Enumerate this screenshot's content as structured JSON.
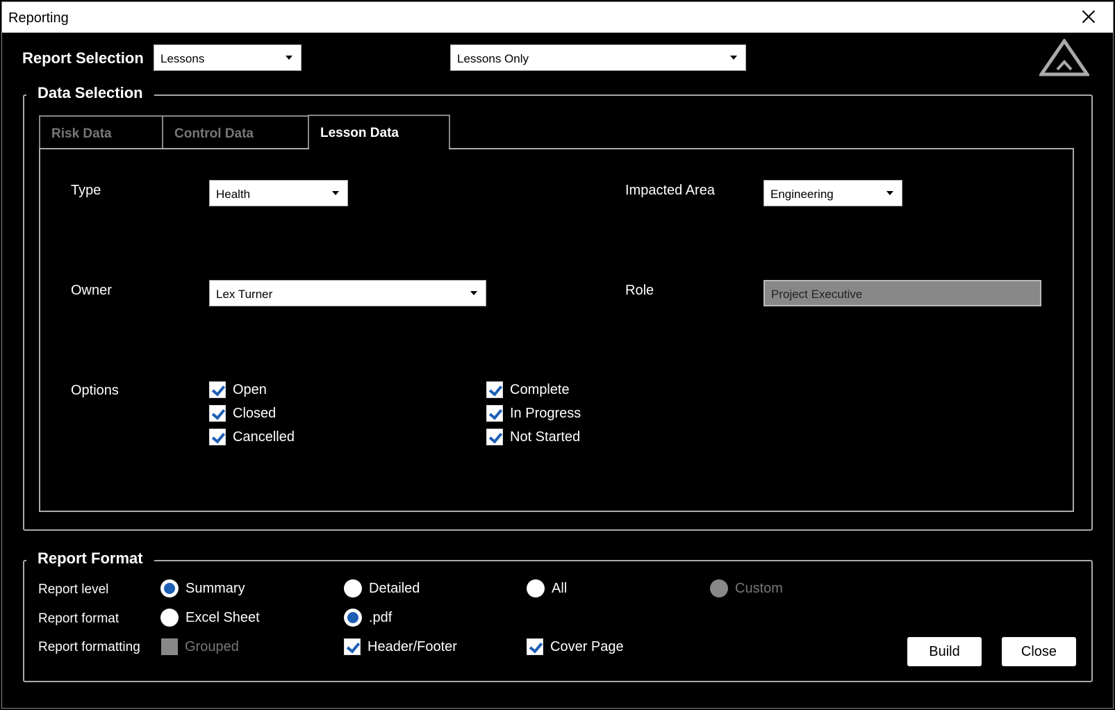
{
  "window": {
    "title": "Reporting",
    "close_icon": "close-icon"
  },
  "report_selection": {
    "label": "Report Selection",
    "report_type": "Lessons",
    "report_filter": "Lessons Only"
  },
  "data_selection": {
    "legend": "Data Selection",
    "tabs": [
      {
        "label": "Risk Data",
        "active": false
      },
      {
        "label": "Control Data",
        "active": false
      },
      {
        "label": "Lesson Data",
        "active": true
      }
    ],
    "lesson": {
      "type_label": "Type",
      "type_value": "Health",
      "impacted_area_label": "Impacted Area",
      "impacted_area_value": "Engineering",
      "owner_label": "Owner",
      "owner_value": "Lex Turner",
      "role_label": "Role",
      "role_value": "Project Executive",
      "options_label": "Options",
      "options": [
        {
          "label": "Open",
          "checked": true
        },
        {
          "label": "Closed",
          "checked": true
        },
        {
          "label": "Cancelled",
          "checked": true
        },
        {
          "label": "Complete",
          "checked": true
        },
        {
          "label": "In Progress",
          "checked": true
        },
        {
          "label": "Not Started",
          "checked": true
        }
      ]
    }
  },
  "report_format": {
    "legend": "Report Format",
    "level_label": "Report level",
    "levels": [
      {
        "label": "Summary",
        "selected": true,
        "disabled": false
      },
      {
        "label": "Detailed",
        "selected": false,
        "disabled": false
      },
      {
        "label": "All",
        "selected": false,
        "disabled": false
      },
      {
        "label": "Custom",
        "selected": false,
        "disabled": true
      }
    ],
    "format_label": "Report format",
    "formats": [
      {
        "label": "Excel Sheet",
        "selected": false
      },
      {
        "label": ".pdf",
        "selected": true
      }
    ],
    "formatting_label": "Report formatting",
    "formatting": [
      {
        "label": "Grouped",
        "checked": false,
        "disabled": true
      },
      {
        "label": "Header/Footer",
        "checked": true,
        "disabled": false
      },
      {
        "label": "Cover Page",
        "checked": true,
        "disabled": false
      }
    ]
  },
  "buttons": {
    "build": "Build",
    "close": "Close"
  },
  "colors": {
    "accent": "#1d5fb5",
    "background": "#000000"
  }
}
